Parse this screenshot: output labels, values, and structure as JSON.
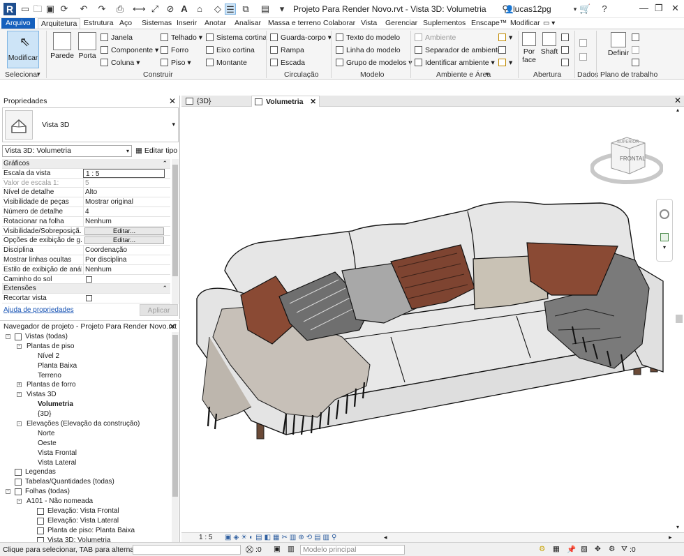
{
  "app": {
    "title": "Projeto Para Render Novo.rvt - Vista 3D: Volumetria",
    "logo_letter": "R",
    "user": "lucas12pg"
  },
  "tabs": [
    "Arquivo",
    "Arquitetura",
    "Estrutura",
    "Aço",
    "Sistemas",
    "Inserir",
    "Anotar",
    "Analisar",
    "Massa e terreno",
    "Colaborar",
    "Vista",
    "Gerenciar",
    "Suplementos",
    "Enscape™",
    "Modificar"
  ],
  "ribbon": {
    "modificar": "Modificar",
    "selecionar": "Selecionar",
    "construir": {
      "label": "Construir",
      "parede": "Parede",
      "porta": "Porta",
      "janela": "Janela",
      "componente": "Componente",
      "coluna": "Coluna",
      "telhado": "Telhado",
      "forro": "Forro",
      "piso": "Piso",
      "sistema_cortina": "Sistema cortina",
      "eixo_cortina": "Eixo cortina",
      "montante": "Montante"
    },
    "circulacao": {
      "label": "Circulação",
      "guarda_corpo": "Guarda-corpo",
      "rampa": "Rampa",
      "escada": "Escada"
    },
    "modelo": {
      "label": "Modelo",
      "texto": "Texto do modelo",
      "linha": "Linha do modelo",
      "grupo": "Grupo de modelos"
    },
    "ambiente": {
      "label": "Ambiente e Área",
      "ambiente": "Ambiente",
      "separador": "Separador de ambiente",
      "identificar": "Identificar ambiente"
    },
    "abertura": {
      "label": "Abertura",
      "por_face": "Por face",
      "shaft": "Shaft"
    },
    "dados": {
      "label": "Dados"
    },
    "plano": {
      "label": "Plano de trabalho",
      "definir": "Definir"
    }
  },
  "properties": {
    "title": "Propriedades",
    "type_name": "Vista 3D",
    "view_selector": "Vista 3D: Volumetria",
    "edit_type": "Editar tipo",
    "rows": [
      {
        "k": "Gráficos",
        "section": true
      },
      {
        "k": "Escala da vista",
        "v": "1 : 5",
        "input": true
      },
      {
        "k": "Valor de escala    1:",
        "v": "5",
        "dim": true
      },
      {
        "k": "Nível de detalhe",
        "v": "Alto"
      },
      {
        "k": "Visibilidade de peças",
        "v": "Mostrar original"
      },
      {
        "k": "Número de detalhe",
        "v": "4"
      },
      {
        "k": "Rotacionar na folha",
        "v": "Nenhum"
      },
      {
        "k": "Visibilidade/Sobreposiçã...",
        "v": "Editar...",
        "button": true
      },
      {
        "k": "Opções de exibição de g...",
        "v": "Editar...",
        "button": true
      },
      {
        "k": "Disciplina",
        "v": "Coordenação"
      },
      {
        "k": "Mostrar linhas ocultas",
        "v": "Por disciplina"
      },
      {
        "k": "Estilo de exibição de anál...",
        "v": "Nenhum"
      },
      {
        "k": "Caminho do sol",
        "v": "",
        "check": true
      },
      {
        "k": "Extensões",
        "section": true
      },
      {
        "k": "Recortar vista",
        "v": "",
        "check": true
      }
    ],
    "help": "Ajuda de propriedades",
    "apply": "Aplicar"
  },
  "browser": {
    "title": "Navegador de projeto - Projeto Para Render Novo.rvt",
    "nodes": [
      {
        "label": "Vistas (todas)",
        "lvl": 0,
        "tg": "-",
        "icon": true
      },
      {
        "label": "Plantas de piso",
        "lvl": 1,
        "tg": "-"
      },
      {
        "label": "Nível 2",
        "lvl": 2
      },
      {
        "label": "Planta Baixa",
        "lvl": 2
      },
      {
        "label": "Terreno",
        "lvl": 2
      },
      {
        "label": "Plantas de forro",
        "lvl": 1,
        "tg": "+"
      },
      {
        "label": "Vistas 3D",
        "lvl": 1,
        "tg": "-"
      },
      {
        "label": "Volumetria",
        "lvl": 2,
        "sel": true
      },
      {
        "label": "{3D}",
        "lvl": 2
      },
      {
        "label": "Elevações (Elevação da construção)",
        "lvl": 1,
        "tg": "-"
      },
      {
        "label": "Norte",
        "lvl": 2
      },
      {
        "label": "Oeste",
        "lvl": 2
      },
      {
        "label": "Vista Frontal",
        "lvl": 2
      },
      {
        "label": "Vista Lateral",
        "lvl": 2
      },
      {
        "label": "Legendas",
        "lvl": 0,
        "icon": true
      },
      {
        "label": "Tabelas/Quantidades (todas)",
        "lvl": 0,
        "icon": true
      },
      {
        "label": "Folhas (todas)",
        "lvl": 0,
        "tg": "-",
        "icon": true
      },
      {
        "label": "A101 - Não nomeada",
        "lvl": 1,
        "tg": "-"
      },
      {
        "label": "Elevação: Vista Frontal",
        "lvl": 2,
        "icon": true
      },
      {
        "label": "Elevação: Vista Lateral",
        "lvl": 2,
        "icon": true
      },
      {
        "label": "Planta de piso: Planta Baixa",
        "lvl": 2,
        "icon": true
      },
      {
        "label": "Vista 3D: Volumetria",
        "lvl": 2,
        "icon": true
      }
    ]
  },
  "view_tabs": [
    {
      "label": "{3D}",
      "active": false
    },
    {
      "label": "Volumetria",
      "active": true
    }
  ],
  "viewcube": {
    "top": "SUPERIOR",
    "front": "FRONTAL"
  },
  "viewbar": {
    "scale": "1 : 5"
  },
  "status": {
    "message": "Clique para selecionar, TAB para alternat",
    "filter_count": ":0",
    "model": "Modelo principal",
    "selection_count": ":0"
  },
  "colors": {
    "accent": "#1560bd",
    "sofa": "#e4e4e4",
    "pillow_brown": "#8a4a34",
    "pillow_grey": "#a8a8a8",
    "pillow_beige": "#c9c2b5",
    "throw_dark": "#5b5b5b"
  }
}
